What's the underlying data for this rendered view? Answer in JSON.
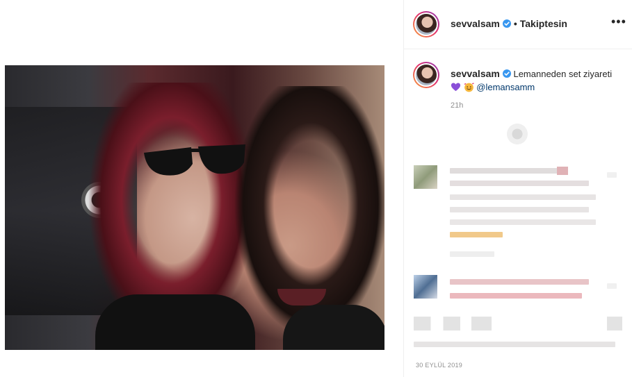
{
  "post": {
    "username": "sevvalsam",
    "follow_state": "Takiptesin",
    "caption_text": "Lemanneden set ziyareti",
    "mention": "@lemansamm",
    "time_ago": "21h",
    "date": "30 EYLÜL 2019"
  },
  "icons": {
    "verified": "verified-badge-icon",
    "more": "more-options-icon",
    "heart": "purple-heart-emoji",
    "smiley": "smiling-face-with-hearts-emoji"
  },
  "colors": {
    "link": "#00376b",
    "verified": "#3897f0",
    "muted": "#8e8e8e"
  }
}
